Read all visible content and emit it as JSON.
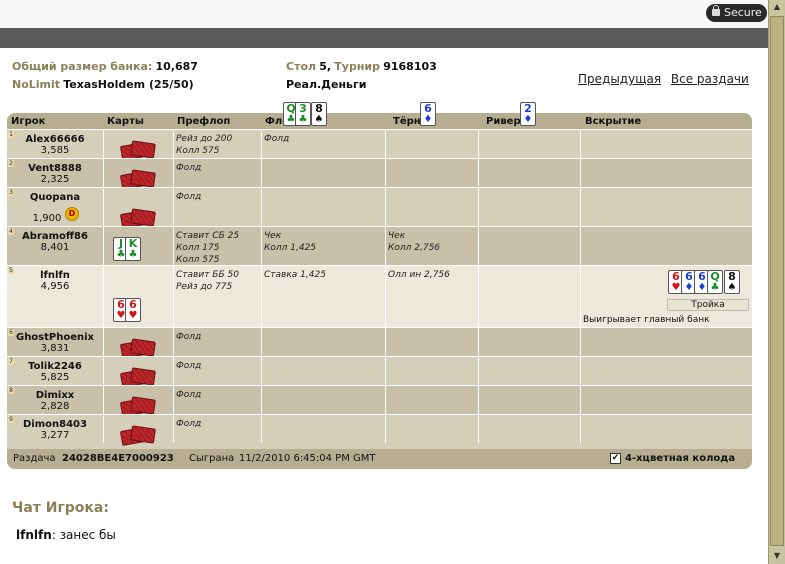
{
  "secure_label": "Secure",
  "info": {
    "pot_label": "Общий размер банка:",
    "pot_value": "10,687",
    "game_label": "NoLimit",
    "game_value": "TexasHoldem (25/50)",
    "table_label": "Стол",
    "table_num": "5,",
    "tourn_label": "Турнир",
    "tourn_id": "9168103",
    "mode": "Реал.Деньги"
  },
  "nav": {
    "prev": "Предыдущая",
    "all": "Все раздачи"
  },
  "headers": {
    "player": "Игрок",
    "cards": "Карты",
    "preflop": "Префлоп",
    "flop": "Флоп",
    "turn": "Тёрн",
    "river": "Ривер",
    "showdown": "Вскрытие"
  },
  "board": {
    "flop": [
      {
        "rank": "Q",
        "suit": "♣",
        "color": "green"
      },
      {
        "rank": "3",
        "suit": "♣",
        "color": "green"
      },
      {
        "rank": "8",
        "suit": "♠",
        "color": "black"
      }
    ],
    "turn": [
      {
        "rank": "6",
        "suit": "♦",
        "color": "blue"
      }
    ],
    "river": [
      {
        "rank": "2",
        "suit": "♦",
        "color": "blue"
      }
    ]
  },
  "players": [
    {
      "seat": "1",
      "name": "Alex66666",
      "chips": "3,585",
      "preflop": [
        "Рейз до 200",
        "Колл 575"
      ],
      "flop": [
        "Фолд"
      ],
      "turn": [],
      "river": []
    },
    {
      "seat": "2",
      "name": "Vent8888",
      "chips": "2,325",
      "preflop": [
        "Фолд"
      ],
      "flop": [],
      "turn": [],
      "river": []
    },
    {
      "seat": "3",
      "name": "Quopana",
      "chips": "1,900",
      "dealer": "D",
      "preflop": [
        "Фолд"
      ],
      "flop": [],
      "turn": [],
      "river": []
    },
    {
      "seat": "4",
      "name": "Abramoff86",
      "chips": "8,401",
      "preflop": [
        "Ставит СБ 25",
        "Колл 175",
        "Колл 575"
      ],
      "flop": [
        "Чек",
        "Колл 1,425"
      ],
      "turn": [
        "Чек",
        "Колл 2,756"
      ],
      "river": [],
      "hole": [
        {
          "rank": "J",
          "suit": "♣",
          "color": "green"
        },
        {
          "rank": "K",
          "suit": "♣",
          "color": "green"
        }
      ]
    },
    {
      "seat": "5",
      "name": "lfnlfn",
      "chips": "4,956",
      "preflop": [
        "Ставит ББ 50",
        "Рейз до 775"
      ],
      "flop": [
        "Ставка 1,425"
      ],
      "turn": [
        "Олл ин 2,756"
      ],
      "river": [],
      "hole": [
        {
          "rank": "6",
          "suit": "♥",
          "color": "red"
        },
        {
          "rank": "6",
          "suit": "♥",
          "color": "red"
        }
      ],
      "showdown_cards": [
        {
          "rank": "6",
          "suit": "♥",
          "color": "red"
        },
        {
          "rank": "6",
          "suit": "♦",
          "color": "blue"
        },
        {
          "rank": "6",
          "suit": "♦",
          "color": "blue"
        },
        {
          "rank": "Q",
          "suit": "♣",
          "color": "green"
        },
        {
          "rank": "8",
          "suit": "♠",
          "color": "black"
        }
      ],
      "hand_name": "Тройка",
      "result": "Выигрывает главный банк"
    },
    {
      "seat": "6",
      "name": "GhostPhoenix",
      "chips": "3,831",
      "preflop": [
        "Фолд"
      ],
      "flop": [],
      "turn": [],
      "river": []
    },
    {
      "seat": "7",
      "name": "Tolik2246",
      "chips": "5,825",
      "preflop": [
        "Фолд"
      ],
      "flop": [],
      "turn": [],
      "river": []
    },
    {
      "seat": "8",
      "name": "Dimixx",
      "chips": "2,828",
      "preflop": [
        "Фолд"
      ],
      "flop": [],
      "turn": [],
      "river": []
    },
    {
      "seat": "9",
      "name": "Dimon8403",
      "chips": "3,277",
      "preflop": [
        "Фолд"
      ],
      "flop": [],
      "turn": [],
      "river": []
    }
  ],
  "footer": {
    "hand_label": "Раздача",
    "hand_id": "24028BE4E7000923",
    "played_label": "Сыграна",
    "played_time": "11/2/2010 6:45:04 PM GMT",
    "deck_label": "4-хцветная колода",
    "deck_checked": true
  },
  "chat": {
    "title": "Чат Игрока:",
    "sender": "lfnlfn",
    "message": "занес бы"
  },
  "colors": {
    "accent": "#8c8058",
    "table_bg": "#d5ceb9",
    "header_bg": "#b7ae92",
    "card_back": "#c0272d"
  }
}
